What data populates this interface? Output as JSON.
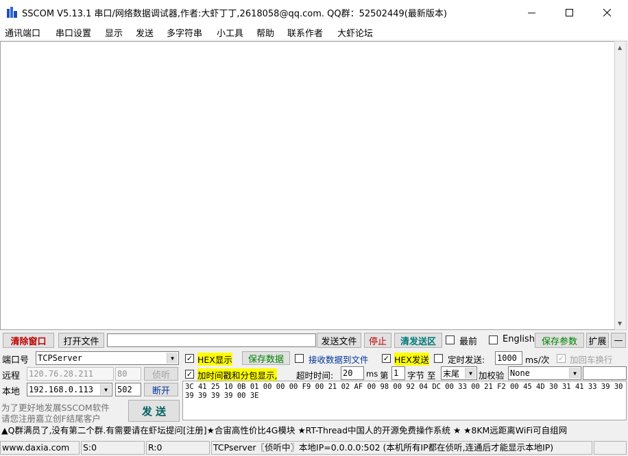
{
  "window": {
    "title": "SSCOM V5.13.1 串口/网络数据调试器,作者:大虾丁丁,2618058@qq.com. QQ群：52502449(最新版本)"
  },
  "menu": [
    "通讯端口",
    "串口设置",
    "显示",
    "发送",
    "多字符串",
    "小工具",
    "帮助",
    "联系作者",
    "大虾论坛"
  ],
  "toolbar": {
    "clear_window": "清除窗口",
    "open_file": "打开文件",
    "file_path": "",
    "send_file": "发送文件",
    "stop": "停止",
    "clear_send": "清发送区",
    "topmost_label": "最前",
    "english_label": "English",
    "save_params": "保存参数",
    "expand": "扩展",
    "collapse": "—"
  },
  "connection": {
    "port_label": "端口号",
    "port_value": "TCPServer",
    "remote_label": "远程",
    "remote_ip": "120.76.28.211",
    "remote_port": "80",
    "listen_button": "侦听",
    "local_label": "本地",
    "local_ip": "192.168.0.113",
    "local_port": "502",
    "disconnect_button": "断开",
    "ad_line1": "为了更好地发展SSCOM软件",
    "ad_line2": "请您注册嘉立创F结尾客户",
    "send_button": "发 送"
  },
  "options": {
    "hex_display": "HEX显示",
    "save_data": "保存数据",
    "recv_to_file": "接收数据到文件",
    "hex_send": "HEX发送",
    "timed_send": "定时发送:",
    "interval_value": "1000",
    "interval_unit": "ms/次",
    "add_crlf": "加回车换行",
    "add_timestamp": "加时间戳和分包显示,",
    "timeout_label": "超时时间:",
    "timeout_value": "20",
    "timeout_unit": "ms",
    "nth_label": "第",
    "byte_start": "1",
    "byte_label": "字节 至",
    "byte_end": "末尾",
    "checksum_label": "加校验",
    "checksum_value": "None",
    "check_mark": "✓"
  },
  "send_data": "3C 41 25 10 0B 01 00 00 00 F9 00 21 02 AF 00 98 00 92 04 DC 00 33 00 21 F2 00 45 4D 30 31 41 33 39 30 39 39 39 39 00 3E",
  "ticker": "▲Q群满员了,没有第二个群.有需要请在虾坛提问[注册]★合宙高性价比4G模块 ★RT-Thread中国人的开源免费操作系统 ★ ★8KM远距离WiFi可自组网",
  "status": {
    "website": "www.daxia.com",
    "sent": "S:0",
    "received": "R:0",
    "info": "TCPserver〖侦听中〗本地IP=0.0.0.0:502 (本机所有IP都在侦听,连通后才能显示本地IP)"
  },
  "colors": {
    "accent_red": "#c00000",
    "accent_green": "#008000",
    "highlight": "#ffff00"
  }
}
